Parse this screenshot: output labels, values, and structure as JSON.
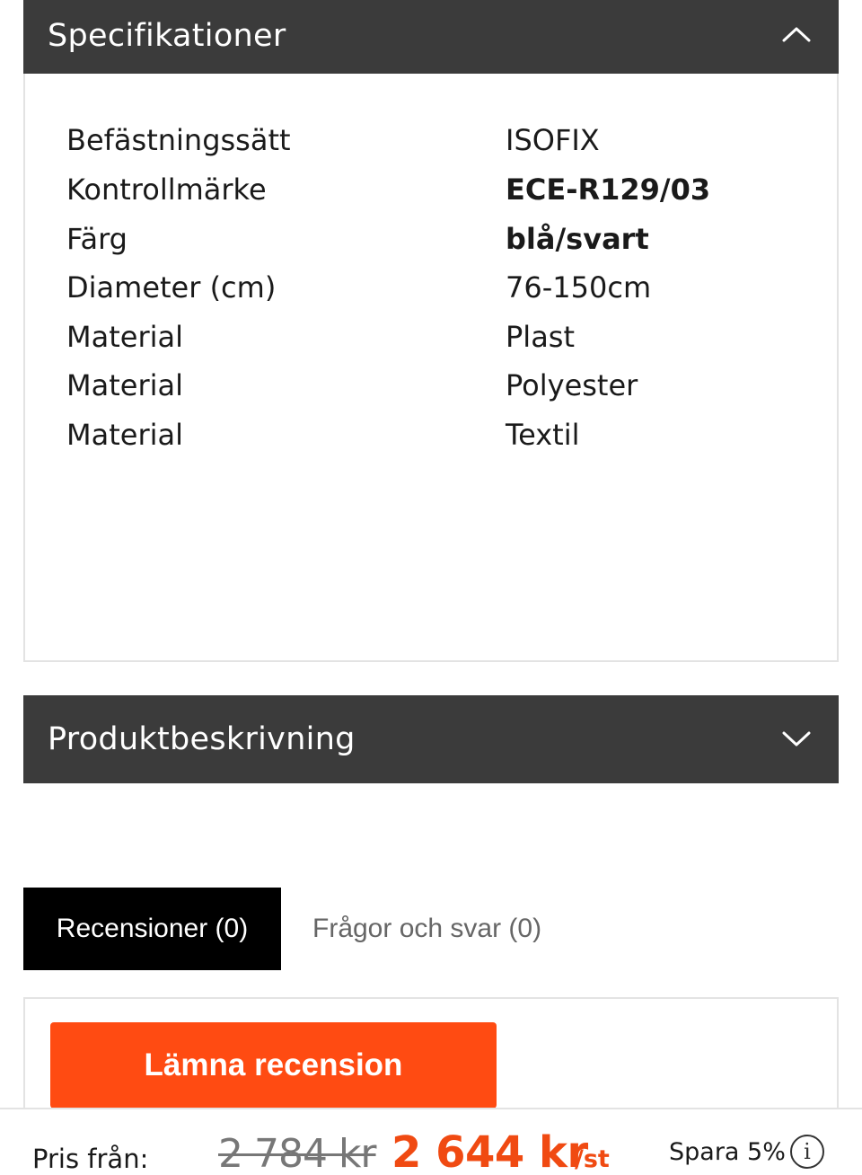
{
  "specifications": {
    "title": "Specifikationer",
    "rows": [
      {
        "label": "Befästningssätt",
        "value": "ISOFIX"
      },
      {
        "label": "Kontrollmärke",
        "value": "ECE-R129/03"
      },
      {
        "label": "Färg",
        "value": "blå/svart"
      },
      {
        "label": "Diameter (cm)",
        "value": "76-150cm"
      },
      {
        "label": "Material",
        "value": "Plast"
      },
      {
        "label": "Material",
        "value": "Polyester"
      },
      {
        "label": "Material",
        "value": "Textil"
      }
    ]
  },
  "description": {
    "title": "Produktbeskrivning"
  },
  "tabs": [
    {
      "label": "Recensioner (0)",
      "active": true
    },
    {
      "label": "Frågor och svar (0)",
      "active": false
    }
  ],
  "review": {
    "button_label": "Lämna recension"
  },
  "price_bar": {
    "from_label": "Pris från:",
    "old_price": "2 784 kr",
    "new_price": "2 644 kr",
    "unit": "/st",
    "save_label": "Spara 5%",
    "info_glyph": "i"
  },
  "colors": {
    "header_bg": "#3b3b3b",
    "accent": "#ff4b12",
    "tab_active_bg": "#000000"
  },
  "icons": {
    "spec_toggle": "chevron-up-icon",
    "desc_toggle": "chevron-down-icon",
    "info": "info-icon"
  }
}
